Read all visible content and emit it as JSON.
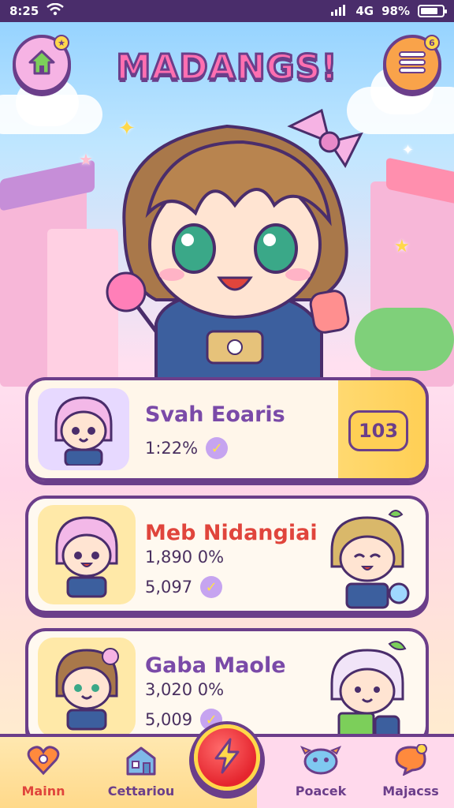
{
  "status_bar": {
    "time": "8:25",
    "signal_text": "4G",
    "battery_label": "98%",
    "battery_level_pct": 80
  },
  "header": {
    "title": "MADANGS!",
    "home_button_icon": "home-icon",
    "menu_button_icon": "menu-icon",
    "menu_badge": "6"
  },
  "players": [
    {
      "name": "Svah Eoaris",
      "line1": "1:22%",
      "score": "103"
    },
    {
      "name": "Meb Nidangiai",
      "line1": "1,890 0%",
      "line2": "5,097"
    },
    {
      "name": "Gaba Maole",
      "line1": "3,020 0%",
      "line2": "5,009"
    }
  ],
  "bottom_nav": {
    "items": [
      {
        "label": "Mainn",
        "icon": "heart-icon"
      },
      {
        "label": "Cettariou",
        "icon": "house-icon"
      },
      {
        "label": "",
        "icon": "lightning-icon"
      },
      {
        "label": "Poacek",
        "icon": "creature-icon"
      },
      {
        "label": "Majacss",
        "icon": "chat-icon"
      }
    ]
  },
  "colors": {
    "outline": "#6b3e8a",
    "accent_red": "#e0453c",
    "accent_yellow": "#ffcf55",
    "accent_purple": "#7a4aa8"
  }
}
